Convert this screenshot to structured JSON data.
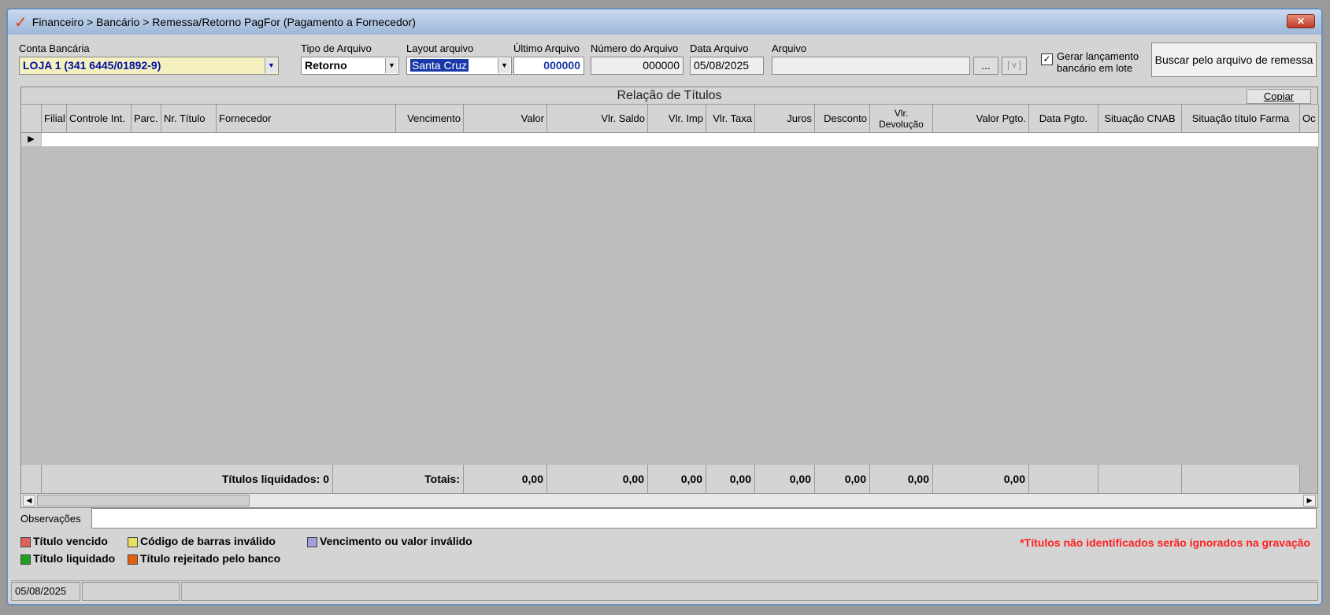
{
  "window": {
    "title": "Financeiro > Bancário > Remessa/Retorno PagFor (Pagamento  a Fornecedor)",
    "close_label": "✕"
  },
  "form": {
    "conta_label": "Conta Bancária",
    "conta_value": "LOJA 1 (341 6445/01892-9)",
    "tipo_label": "Tipo de Arquivo",
    "tipo_value": "Retorno",
    "layout_label": "Layout arquivo",
    "layout_value": "Santa Cruz",
    "ultimo_label": "Último Arquivo",
    "ultimo_value": "000000",
    "numero_label": "Número do Arquivo",
    "numero_value": "000000",
    "data_label": "Data Arquivo",
    "data_value": "05/08/2025",
    "arquivo_label": "Arquivo",
    "arquivo_value": "",
    "browse_label": "...",
    "view_label": "[ v ]",
    "gerar_label_1": "Gerar lançamento",
    "gerar_label_2": "bancário em lote",
    "buscar_label": "Buscar pelo arquivo de remessa"
  },
  "grid": {
    "title": "Relação de Títulos",
    "copy_label": "Copiar",
    "columns": [
      "Filial",
      "Controle Int.",
      "Parc.",
      "Nr. Título",
      "Fornecedor",
      "Vencimento",
      "Valor",
      "Vlr. Saldo",
      "Vlr. Imp",
      "Vlr. Taxa",
      "Juros",
      "Desconto",
      "Vlr. Devolução",
      "Valor Pgto.",
      "Data Pgto.",
      "Situação CNAB",
      "Situação título Farma",
      "Oc"
    ],
    "titulos_liquidados": "Títulos liquidados: 0",
    "totais_label": "Totais:",
    "totals": [
      "0,00",
      "0,00",
      "0,00",
      "0,00",
      "0,00",
      "0,00",
      "0,00",
      "0,00"
    ]
  },
  "observacoes_label": "Observações",
  "legend": {
    "vencido": "Título vencido",
    "codigo": "Código de barras inválido",
    "venc_valor": "Vencimento ou valor inválido",
    "liquidado": "Título liquidado",
    "rejeitado": "Título rejeitado pelo banco",
    "warning": "*Títulos não identificados serão ignorados na gravação",
    "colors": {
      "vencido": "#e06060",
      "codigo": "#e8e060",
      "venc_valor": "#a0a0e0",
      "liquidado": "#20a020",
      "rejeitado": "#e06010"
    }
  },
  "status": {
    "date": "05/08/2025"
  }
}
